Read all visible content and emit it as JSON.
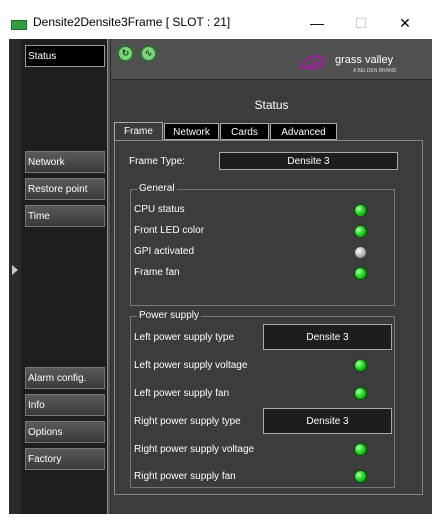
{
  "window": {
    "title": "Densite2Densite3Frame [ SLOT : 21]",
    "minimize_label": "—",
    "maximize_label": "☐",
    "close_label": "✕"
  },
  "sidebar": {
    "items": [
      {
        "label": "Status"
      },
      {
        "label": "Network"
      },
      {
        "label": "Restore point"
      },
      {
        "label": "Time"
      },
      {
        "label": "Alarm config."
      },
      {
        "label": "Info"
      },
      {
        "label": "Options"
      },
      {
        "label": "Factory"
      }
    ]
  },
  "header": {
    "icons": [
      "refresh-icon",
      "monitor-icon"
    ],
    "logo_text": "grass valley",
    "logo_sub": "A BELDEN BRAND"
  },
  "page": {
    "title": "Status"
  },
  "tabs": [
    {
      "label": "Frame",
      "active": true
    },
    {
      "label": "Network"
    },
    {
      "label": "Cards"
    },
    {
      "label": "Advanced"
    }
  ],
  "frame": {
    "frame_type_label": "Frame Type:",
    "frame_type_value": "Densite 3",
    "general": {
      "title": "General",
      "items": [
        {
          "label": "CPU status",
          "led": "green"
        },
        {
          "label": "Front LED color",
          "led": "green"
        },
        {
          "label": "GPI activated",
          "led": "grey"
        },
        {
          "label": "Frame fan",
          "led": "green"
        }
      ]
    },
    "power": {
      "title": "Power supply",
      "left_type_label": "Left power supply type",
      "left_type_value": "Densite 3",
      "left_voltage_label": "Left power supply voltage",
      "left_fan_label": "Left power supply fan",
      "right_type_label": "Right power supply type",
      "right_type_value": "Densite 3",
      "right_voltage_label": "Right power supply voltage",
      "right_fan_label": "Right power supply fan"
    }
  },
  "colors": {
    "led_green": "#28e028",
    "led_grey": "#bcbcbc",
    "logo_purple": "#8a2d8a"
  }
}
